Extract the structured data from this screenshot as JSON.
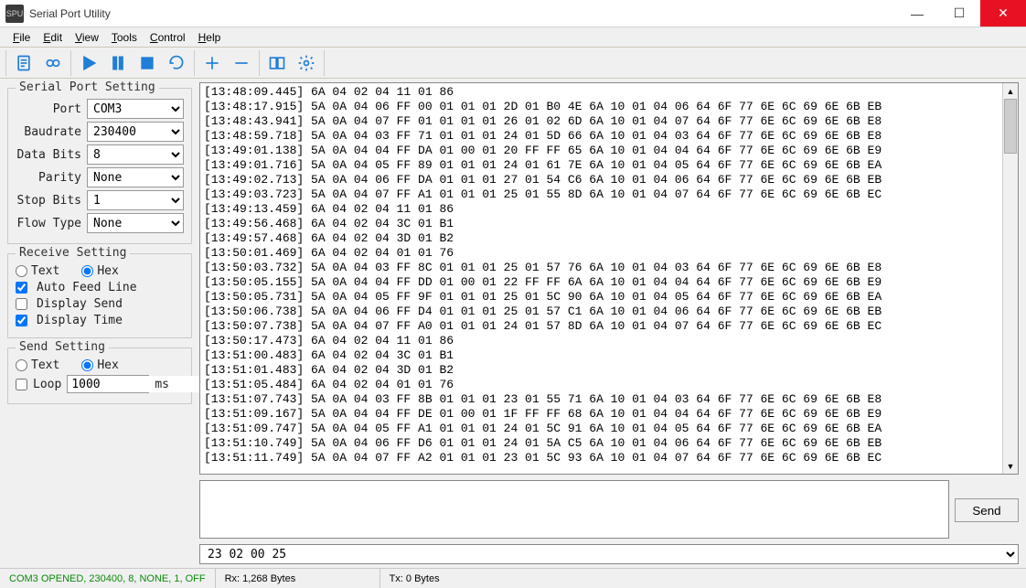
{
  "window": {
    "title": "Serial Port Utility"
  },
  "menu": {
    "file": "File",
    "edit": "Edit",
    "view": "View",
    "tools": "Tools",
    "control": "Control",
    "help": "Help"
  },
  "serial_port_setting": {
    "legend": "Serial Port Setting",
    "port_label": "Port",
    "port_value": "COM3",
    "baud_label": "Baudrate",
    "baud_value": "230400",
    "databits_label": "Data Bits",
    "databits_value": "8",
    "parity_label": "Parity",
    "parity_value": "None",
    "stopbits_label": "Stop Bits",
    "stopbits_value": "1",
    "flow_label": "Flow Type",
    "flow_value": "None"
  },
  "receive_setting": {
    "legend": "Receive Setting",
    "text_label": "Text",
    "hex_label": "Hex",
    "auto_feed_label": "Auto Feed Line",
    "display_send_label": "Display Send",
    "display_time_label": "Display Time"
  },
  "send_setting": {
    "legend": "Send Setting",
    "text_label": "Text",
    "hex_label": "Hex",
    "loop_label": "Loop",
    "loop_value": "1000",
    "ms_label": "ms"
  },
  "recv": {
    "lines": [
      "[13:48:09.445] 6A 04 02 04 11 01 86",
      "[13:48:17.915] 5A 0A 04 06 FF 00 01 01 01 2D 01 B0 4E 6A 10 01 04 06 64 6F 77 6E 6C 69 6E 6B EB",
      "[13:48:43.941] 5A 0A 04 07 FF 01 01 01 01 26 01 02 6D 6A 10 01 04 07 64 6F 77 6E 6C 69 6E 6B E8",
      "[13:48:59.718] 5A 0A 04 03 FF 71 01 01 01 24 01 5D 66 6A 10 01 04 03 64 6F 77 6E 6C 69 6E 6B E8",
      "[13:49:01.138] 5A 0A 04 04 FF DA 01 00 01 20 FF FF 65 6A 10 01 04 04 64 6F 77 6E 6C 69 6E 6B E9",
      "[13:49:01.716] 5A 0A 04 05 FF 89 01 01 01 24 01 61 7E 6A 10 01 04 05 64 6F 77 6E 6C 69 6E 6B EA",
      "[13:49:02.713] 5A 0A 04 06 FF DA 01 01 01 27 01 54 C6 6A 10 01 04 06 64 6F 77 6E 6C 69 6E 6B EB",
      "[13:49:03.723] 5A 0A 04 07 FF A1 01 01 01 25 01 55 8D 6A 10 01 04 07 64 6F 77 6E 6C 69 6E 6B EC",
      "[13:49:13.459] 6A 04 02 04 11 01 86",
      "[13:49:56.468] 6A 04 02 04 3C 01 B1",
      "[13:49:57.468] 6A 04 02 04 3D 01 B2",
      "[13:50:01.469] 6A 04 02 04 01 01 76",
      "[13:50:03.732] 5A 0A 04 03 FF 8C 01 01 01 25 01 57 76 6A 10 01 04 03 64 6F 77 6E 6C 69 6E 6B E8",
      "[13:50:05.155] 5A 0A 04 04 FF DD 01 00 01 22 FF FF 6A 6A 10 01 04 04 64 6F 77 6E 6C 69 6E 6B E9",
      "[13:50:05.731] 5A 0A 04 05 FF 9F 01 01 01 25 01 5C 90 6A 10 01 04 05 64 6F 77 6E 6C 69 6E 6B EA",
      "[13:50:06.738] 5A 0A 04 06 FF D4 01 01 01 25 01 57 C1 6A 10 01 04 06 64 6F 77 6E 6C 69 6E 6B EB",
      "[13:50:07.738] 5A 0A 04 07 FF A0 01 01 01 24 01 57 8D 6A 10 01 04 07 64 6F 77 6E 6C 69 6E 6B EC",
      "[13:50:17.473] 6A 04 02 04 11 01 86",
      "[13:51:00.483] 6A 04 02 04 3C 01 B1",
      "[13:51:01.483] 6A 04 02 04 3D 01 B2",
      "[13:51:05.484] 6A 04 02 04 01 01 76",
      "[13:51:07.743] 5A 0A 04 03 FF 8B 01 01 01 23 01 55 71 6A 10 01 04 03 64 6F 77 6E 6C 69 6E 6B E8",
      "[13:51:09.167] 5A 0A 04 04 FF DE 01 00 01 1F FF FF 68 6A 10 01 04 04 64 6F 77 6E 6C 69 6E 6B E9",
      "[13:51:09.747] 5A 0A 04 05 FF A1 01 01 01 24 01 5C 91 6A 10 01 04 05 64 6F 77 6E 6C 69 6E 6B EA",
      "[13:51:10.749] 5A 0A 04 06 FF D6 01 01 01 24 01 5A C5 6A 10 01 04 06 64 6F 77 6E 6C 69 6E 6B EB",
      "[13:51:11.749] 5A 0A 04 07 FF A2 01 01 01 23 01 5C 93 6A 10 01 04 07 64 6F 77 6E 6C 69 6E 6B EC"
    ]
  },
  "cmd": {
    "value": "23 02 00 25"
  },
  "send": {
    "button_label": "Send"
  },
  "status": {
    "port": "COM3 OPENED, 230400, 8, NONE, 1, OFF",
    "rx": "Rx: 1,268 Bytes",
    "tx": "Tx: 0 Bytes"
  }
}
